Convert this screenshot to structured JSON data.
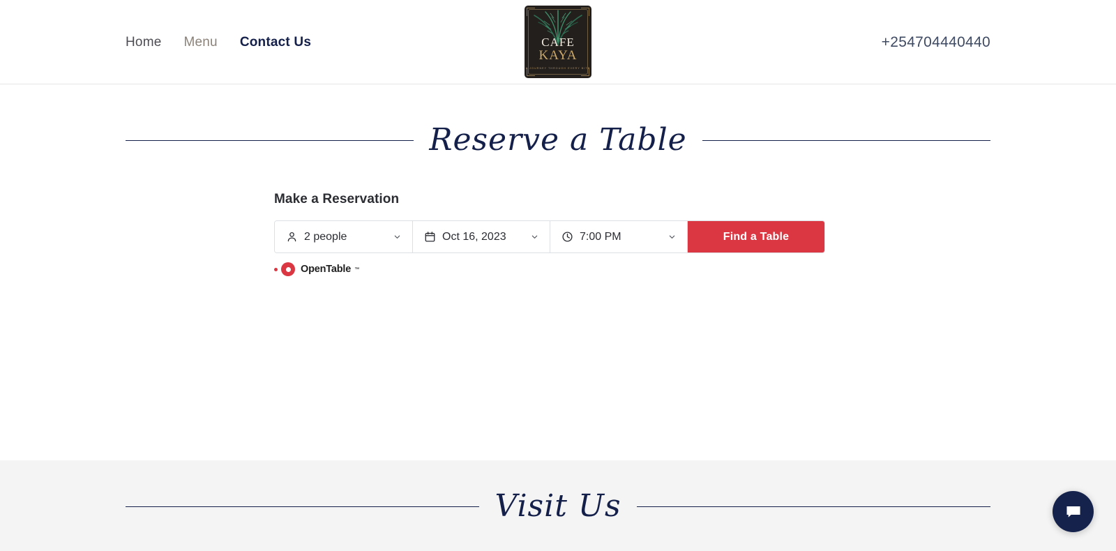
{
  "header": {
    "nav": [
      {
        "label": "Home",
        "state": "default"
      },
      {
        "label": "Menu",
        "state": "muted"
      },
      {
        "label": "Contact Us",
        "state": "active"
      }
    ],
    "logo": {
      "name": "cafe-kaya-logo",
      "word1": "CAFE",
      "word2": "KAYA",
      "tagline": "A JOURNEY THROUGH EVERY BITE"
    },
    "phone": "+254704440440"
  },
  "reserve_section": {
    "heading": "Reserve a Table",
    "widget": {
      "title": "Make a Reservation",
      "party_size": "2 people",
      "date": "Oct 16, 2023",
      "time": "7:00 PM",
      "submit_label": "Find a Table",
      "brand": "OpenTable",
      "brand_tm": "™"
    }
  },
  "visit_section": {
    "heading": "Visit Us"
  },
  "chat": {
    "icon": "chat-bubble-icon"
  },
  "colors": {
    "navy": "#15204a",
    "brand_red": "#da3743",
    "muted_nav": "#8b8279",
    "section_bg": "#f4f4f4",
    "gold": "#c9a86a",
    "chat_bg": "#14224c"
  }
}
